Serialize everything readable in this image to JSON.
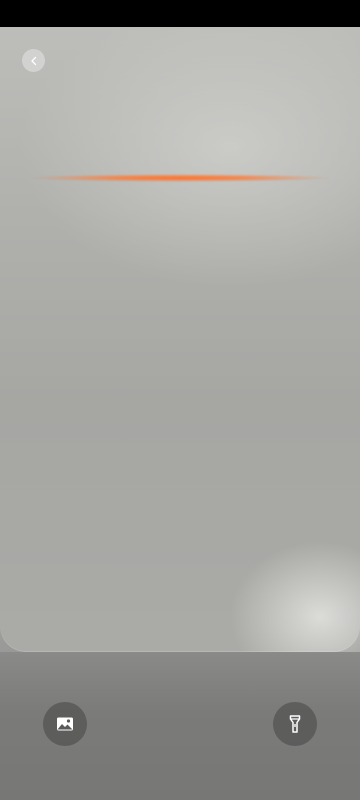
{
  "screen": {
    "name": "qr-scanner",
    "colors": {
      "status_bar": "#000000",
      "scan_line": "#ff7a3a",
      "button_bg": "#474747",
      "icon": "#ffffff"
    }
  },
  "toolbar": {
    "back": {
      "icon": "chevron-left-icon"
    }
  },
  "actions": {
    "gallery": {
      "icon": "image-icon"
    },
    "flashlight": {
      "icon": "flashlight-icon"
    }
  }
}
